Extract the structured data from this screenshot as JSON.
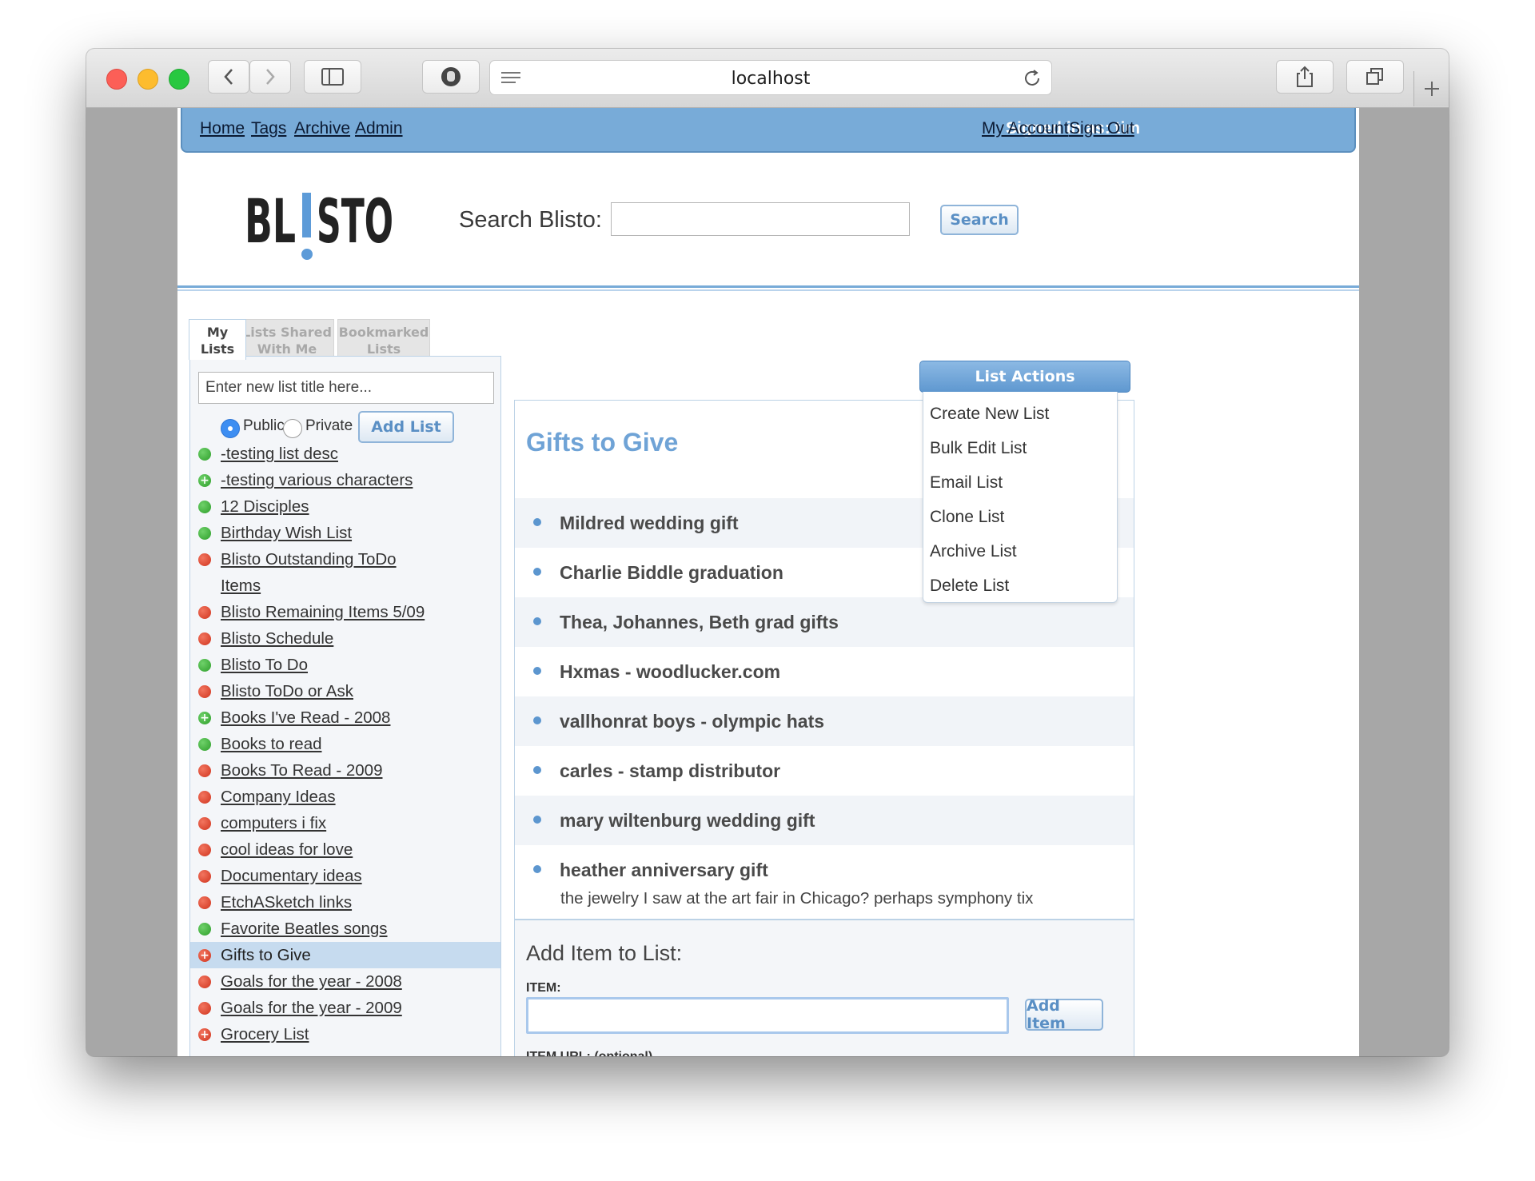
{
  "browser": {
    "url": "localhost"
  },
  "topnav": {
    "links": [
      "Home",
      "Tags",
      "Archive",
      "Admin"
    ],
    "signed_in": "Signed in as: tim",
    "my_account": "My Account",
    "sign_out": "Sign Out"
  },
  "header": {
    "logo_text": "BL!STO",
    "search_label": "Search Blisto:",
    "search_value": "",
    "search_button": "Search"
  },
  "sidebar": {
    "tabs": [
      {
        "label": "My Lists",
        "line1": "My",
        "line2": "Lists",
        "active": true
      },
      {
        "label": "Lists Shared With Me",
        "line1": "Lists Shared",
        "line2": "With Me",
        "active": false
      },
      {
        "label": "Bookmarked Lists",
        "line1": "Bookmarked",
        "line2": "Lists",
        "active": false
      }
    ],
    "new_list_placeholder": "Enter new list title here...",
    "visibility": {
      "public_label": "Public",
      "private_label": "Private",
      "selected": "Public"
    },
    "add_list_button": "Add List",
    "lists": [
      {
        "title": "-testing list desc",
        "status": "green"
      },
      {
        "title": "-testing various characters",
        "status": "green-plus"
      },
      {
        "title": "12 Disciples",
        "status": "green"
      },
      {
        "title": "Birthday Wish List",
        "status": "green"
      },
      {
        "title": "Blisto Outstanding ToDo Items",
        "status": "red"
      },
      {
        "title": "Blisto Remaining Items 5/09",
        "status": "red"
      },
      {
        "title": "Blisto Schedule",
        "status": "red"
      },
      {
        "title": "Blisto To Do",
        "status": "green"
      },
      {
        "title": "Blisto ToDo or Ask",
        "status": "red"
      },
      {
        "title": "Books I've Read - 2008",
        "status": "green-plus"
      },
      {
        "title": "Books to read",
        "status": "green"
      },
      {
        "title": "Books To Read - 2009",
        "status": "red"
      },
      {
        "title": "Company Ideas",
        "status": "red"
      },
      {
        "title": "computers i fix",
        "status": "red"
      },
      {
        "title": "cool ideas for love",
        "status": "red"
      },
      {
        "title": "Documentary ideas",
        "status": "red"
      },
      {
        "title": "EtchASketch links",
        "status": "red"
      },
      {
        "title": "Favorite Beatles songs",
        "status": "green"
      },
      {
        "title": "Gifts to Give",
        "status": "red-plus",
        "selected": true
      },
      {
        "title": "Goals for the year - 2008",
        "status": "red"
      },
      {
        "title": "Goals for the year - 2009",
        "status": "red"
      },
      {
        "title": "Grocery List",
        "status": "red-plus"
      }
    ]
  },
  "main": {
    "list_title": "Gifts to Give",
    "items": [
      {
        "text": "Mildred wedding gift"
      },
      {
        "text": "Charlie Biddle graduation"
      },
      {
        "text": "Thea, Johannes, Beth grad gifts"
      },
      {
        "text": "Hxmas - woodlucker.com"
      },
      {
        "text": "vallhonrat boys - olympic hats"
      },
      {
        "text": "carles - stamp distributor"
      },
      {
        "text": "mary wiltenburg wedding gift"
      },
      {
        "text": "heather anniversary gift",
        "description": "the jewelry I saw at the art fair in Chicago? perhaps symphony tix"
      }
    ],
    "add_item": {
      "heading": "Add Item to List:",
      "item_label": "ITEM:",
      "item_value": "",
      "add_button": "Add Item",
      "url_label": "ITEM URL: (optional)",
      "url_value": ""
    }
  },
  "list_actions": {
    "button": "List Actions",
    "menu": [
      "Create New List",
      "Bulk Edit List",
      "Email List",
      "Clone List",
      "Archive List",
      "Delete List"
    ]
  },
  "colors": {
    "nav_bar": "#78abd8",
    "accent": "#6fa3d6",
    "selected_row": "#c6dbef"
  }
}
